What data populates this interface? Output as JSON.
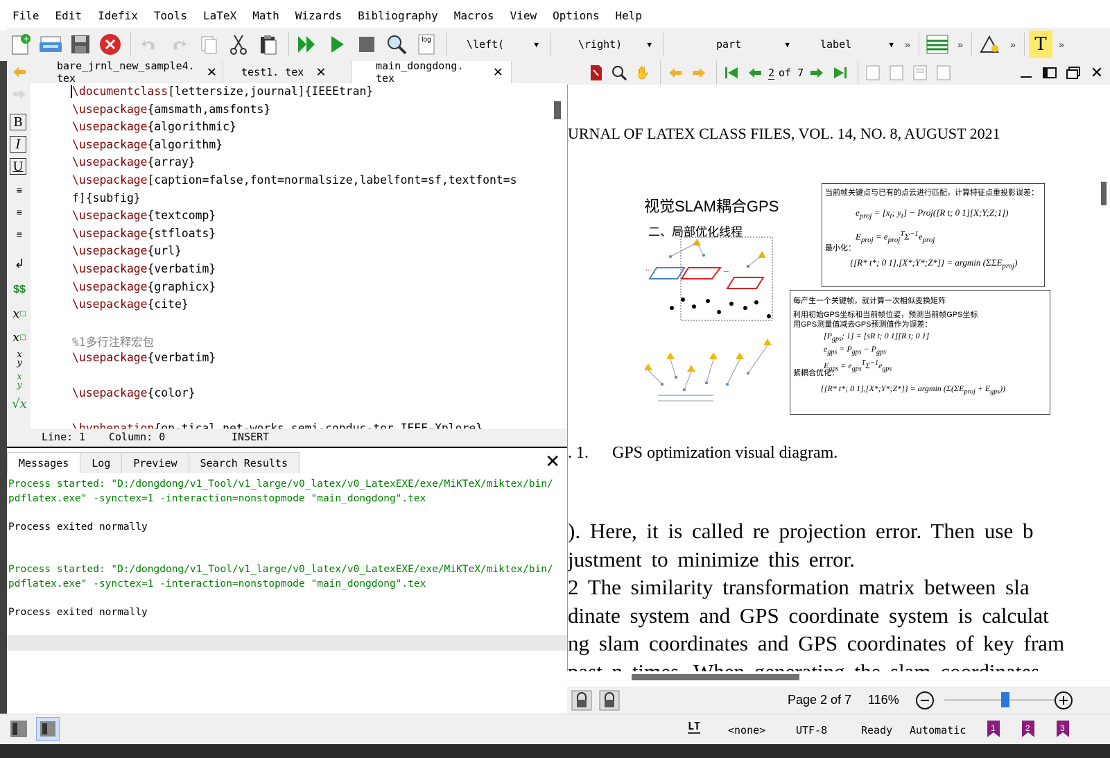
{
  "menu": [
    "File",
    "Edit",
    "Idefix",
    "Tools",
    "LaTeX",
    "Math",
    "Wizards",
    "Bibliography",
    "Macros",
    "View",
    "Options",
    "Help"
  ],
  "toolbar": {
    "combo_left": "\\left(",
    "combo_right": "\\right)",
    "combo_part": "part",
    "combo_label": "label",
    "log_label": "log",
    "chevron": "»"
  },
  "tabs": [
    {
      "label": "bare_jrnl_new_sample4. tex",
      "active": false
    },
    {
      "label": "test1. tex",
      "active": false
    },
    {
      "label": "main_dongdong. tex",
      "active": true
    }
  ],
  "editor_lines": [
    {
      "cmd": "\\documentclass",
      "rest": "[lettersize,journal]{IEEEtran}"
    },
    {
      "cmd": "\\usepackage",
      "rest": "{amsmath,amsfonts}"
    },
    {
      "cmd": "\\usepackage",
      "rest": "{algorithmic}"
    },
    {
      "cmd": "\\usepackage",
      "rest": "{algorithm}"
    },
    {
      "cmd": "\\usepackage",
      "rest": "{array}"
    },
    {
      "cmd": "\\usepackage",
      "rest": "[caption=false,font=normalsize,labelfont=sf,textfont=s"
    },
    {
      "cmd": "",
      "rest": "f]{subfig}"
    },
    {
      "cmd": "\\usepackage",
      "rest": "{textcomp}"
    },
    {
      "cmd": "\\usepackage",
      "rest": "{stfloats}"
    },
    {
      "cmd": "\\usepackage",
      "rest": "{url}"
    },
    {
      "cmd": "\\usepackage",
      "rest": "{verbatim}"
    },
    {
      "cmd": "\\usepackage",
      "rest": "{graphicx}"
    },
    {
      "cmd": "\\usepackage",
      "rest": "{cite}"
    },
    {
      "cmd": "",
      "rest": ""
    },
    {
      "cmd": "",
      "rest": "",
      "comment": "%1多行注释宏包"
    },
    {
      "cmd": "\\usepackage",
      "rest": "{verbatim}"
    },
    {
      "cmd": "",
      "rest": ""
    },
    {
      "cmd": "\\usepackage",
      "rest": "{color}"
    },
    {
      "cmd": "",
      "rest": ""
    },
    {
      "cmd": "\\hyphenation",
      "rest": "{op-tical net-works semi-conduc-tor IEEE-Xplore}"
    }
  ],
  "status": {
    "line": "Line: 1",
    "column": "Column: 0",
    "mode": "INSERT"
  },
  "messages": {
    "tabs": [
      "Messages",
      "Log",
      "Preview",
      "Search Results"
    ],
    "lines": [
      {
        "text": "Process started: \"D:/dongdong/v1_Tool/v1_large/v0_latex/v0_LatexEXE/exe/MiKTeX/miktex/bin/",
        "green": true
      },
      {
        "text": "pdflatex.exe\" -synctex=1 -interaction=nonstopmode \"main_dongdong\".tex",
        "green": true
      },
      {
        "text": "",
        "green": false
      },
      {
        "text": "Process exited normally",
        "green": false
      },
      {
        "text": "",
        "green": false
      },
      {
        "text": "",
        "green": false
      },
      {
        "text": "Process started: \"D:/dongdong/v1_Tool/v1_large/v0_latex/v0_LatexEXE/exe/MiKTeX/miktex/bin/",
        "green": true
      },
      {
        "text": "pdflatex.exe\" -synctex=1 -interaction=nonstopmode \"main_dongdong\".tex",
        "green": true
      },
      {
        "text": "",
        "green": false
      },
      {
        "text": "Process exited normally",
        "green": false
      }
    ]
  },
  "viewer": {
    "page_input": "2",
    "page_of": "of 7",
    "status_page": "Page 2 of 7",
    "zoom": "116%",
    "zoom_slider": 0.55
  },
  "pdf": {
    "header": "URNAL OF LATEX CLASS FILES, VOL. 14, NO. 8, AUGUST 2021",
    "figure_title": "视觉SLAM耦合GPS",
    "figure_subtitle": "二、局部优化线程",
    "box1_text1": "当前帧关键点与已有的点云进行匹配，计算特征点重投影误差：",
    "box1_text2": "最小化：",
    "box2_text1": "每产生一个关键帧，就计算一次相似变换矩阵",
    "box2_text2": "利用初始GPS坐标和当前帧位姿，预测当前帧GPS坐标",
    "box2_text3": "用GPS测量值减去GPS预测值作为误差：",
    "box2_text4": "紧耦合优化：",
    "caption_num": ". 1.",
    "caption": "GPS optimization visual diagram.",
    "body_lines": [
      "). Here, it is called re projection error. Then use b",
      "justment to minimize this error.",
      "2 The similarity transformation matrix between sla",
      "dinate system and GPS coordinate system is calculat",
      "ng slam coordinates and GPS coordinates of key fram",
      "past n times. When generating the slam coordinates"
    ]
  },
  "bottom": {
    "lt": "LT",
    "none": "<none>",
    "enc": "UTF-8",
    "ready": "Ready",
    "automatic": "Automatic"
  },
  "colors": {
    "cmd": "#800000",
    "green": "#008000",
    "comment": "#808080"
  }
}
